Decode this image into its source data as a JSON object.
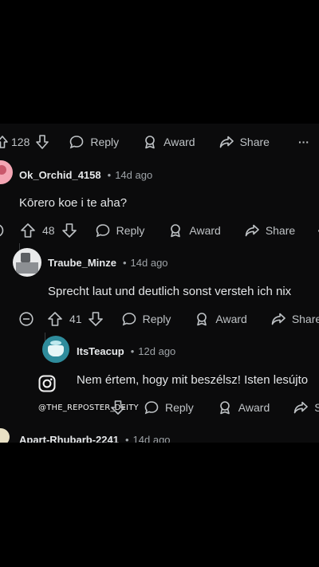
{
  "top_row": {
    "score": "128",
    "reply": "Reply",
    "award": "Award",
    "share": "Share",
    "more": "···"
  },
  "comments": [
    {
      "username": "Ok_Orchid_4158",
      "age": "14d ago",
      "text": "Kōrero koe i te aha?",
      "score": "48",
      "reply": "Reply",
      "award": "Award",
      "share": "Share",
      "more": "···"
    },
    {
      "username": "Traube_Minze",
      "age": "14d ago",
      "text": "Sprecht laut und deutlich sonst versteh ich nix",
      "score": "41",
      "reply": "Reply",
      "award": "Award",
      "share": "Share"
    },
    {
      "username": "ItsTeacup",
      "age": "12d ago",
      "text": "Nem értem, hogy mit beszélsz! Isten lesújto",
      "reply": "Reply",
      "award": "Award",
      "share": "S"
    },
    {
      "username": "Apart-Rhubarb-2241",
      "age": "14d ago"
    }
  ],
  "dot": "•",
  "watermark": {
    "handle": "@THE_REPOSTER_DEITY",
    "icon": "instagram-icon"
  },
  "colors": {
    "background": "#000000",
    "panel": "#0b0b0c",
    "text": "#d7dadc",
    "meta": "#9ea3a7"
  }
}
